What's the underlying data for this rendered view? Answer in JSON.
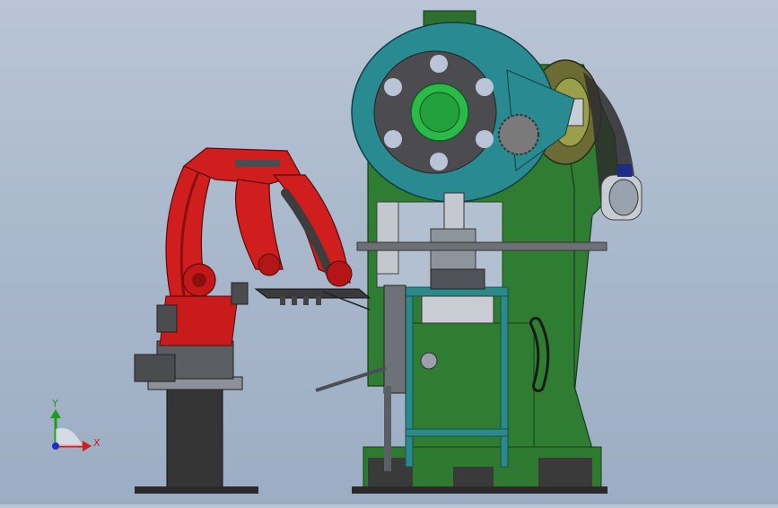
{
  "viewport": {
    "colors": {
      "bg_top": "#b9c5d6",
      "bg_bottom": "#9cadc3",
      "press_body": "#2f7d32",
      "flywheel_ring": "#2a8a91",
      "robot": "#d01d1d",
      "stand_frame": "#2a8a8a",
      "pedestal": "#3a3a3a"
    },
    "model": {
      "robot_arm": "robot-arm",
      "press": "punch-press",
      "flywheel": "flywheel",
      "feeder_frame": "feeder-frame"
    }
  },
  "triad": {
    "x_label": "X",
    "y_label": "Y",
    "x_color": "#cc1f1f",
    "y_color": "#1f9b1f",
    "z_color": "#1f2bcc"
  }
}
